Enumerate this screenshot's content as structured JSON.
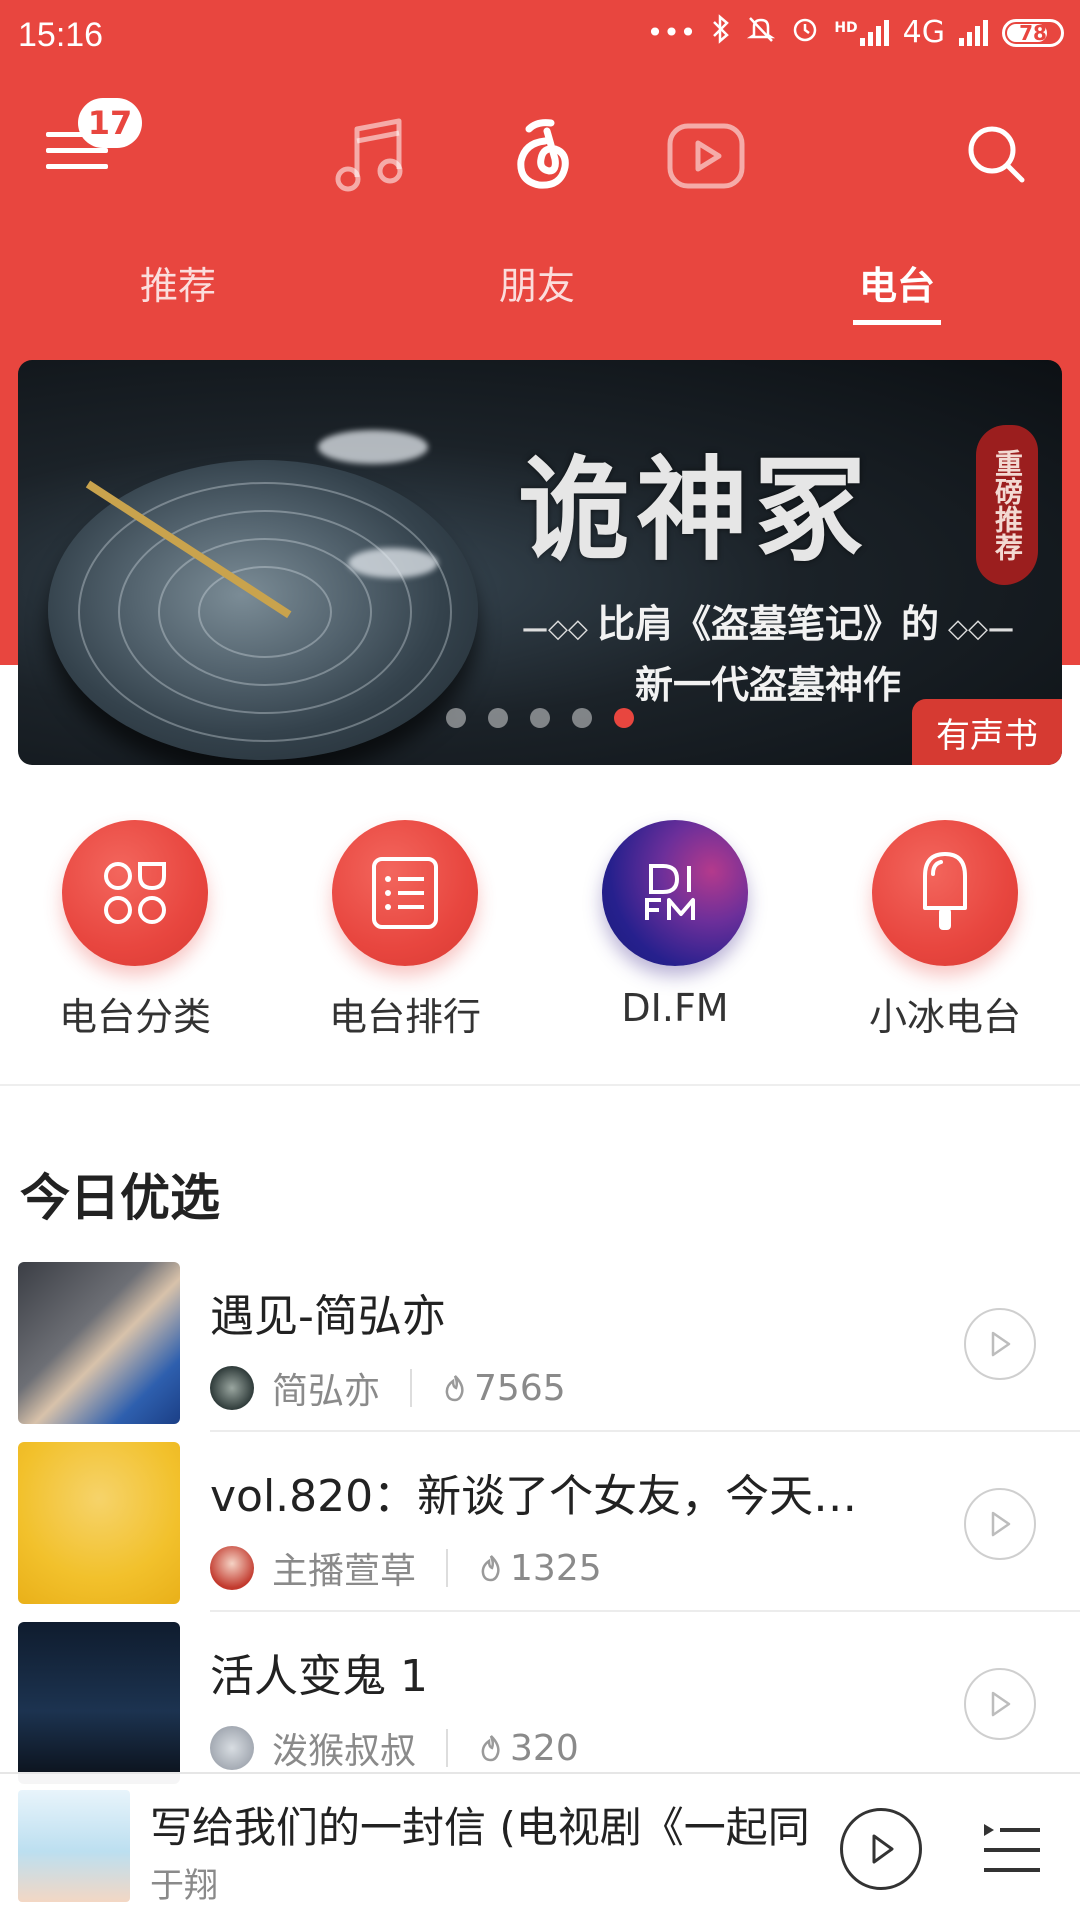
{
  "status_bar": {
    "time": "15:16",
    "network": "4G",
    "hd": "HD",
    "battery": "78",
    "battery_level": 0.78
  },
  "header": {
    "notification_count": "17",
    "icons": [
      "menu-icon",
      "music-note-icon",
      "netease-cloud-icon",
      "video-icon",
      "search-icon"
    ]
  },
  "tabs": [
    {
      "label": "推荐",
      "active": false
    },
    {
      "label": "朋友",
      "active": false
    },
    {
      "label": "电台",
      "active": true
    }
  ],
  "banner": {
    "title": "诡神冢",
    "seal": "重磅推荐",
    "subtitle_line1": "比肩《盗墓笔记》的",
    "subtitle_line2": "新一代盗墓神作",
    "tag": "有声书",
    "page_count": 5,
    "active_page": 5
  },
  "categories": [
    {
      "label": "电台分类",
      "icon": "category-grid-icon"
    },
    {
      "label": "电台排行",
      "icon": "ranking-list-icon"
    },
    {
      "label": "DI.FM",
      "icon": "difm-logo-icon"
    },
    {
      "label": "小冰电台",
      "icon": "popsicle-icon"
    }
  ],
  "today": {
    "title": "今日优选",
    "items": [
      {
        "title": "遇见-简弘亦",
        "host": "简弘亦",
        "plays": "7565"
      },
      {
        "title": "vol.820：新谈了个女友，今天…",
        "host": "主播萱草",
        "plays": "1325"
      },
      {
        "title": "活人变鬼 1",
        "host": "泼猴叔叔",
        "plays": "320"
      }
    ]
  },
  "mini_player": {
    "title": "写给我们的一封信 (电视剧《一起同",
    "artist": "于翔"
  },
  "colors": {
    "accent": "#e8463f",
    "text": "#222222",
    "muted": "#8a8a8a"
  }
}
